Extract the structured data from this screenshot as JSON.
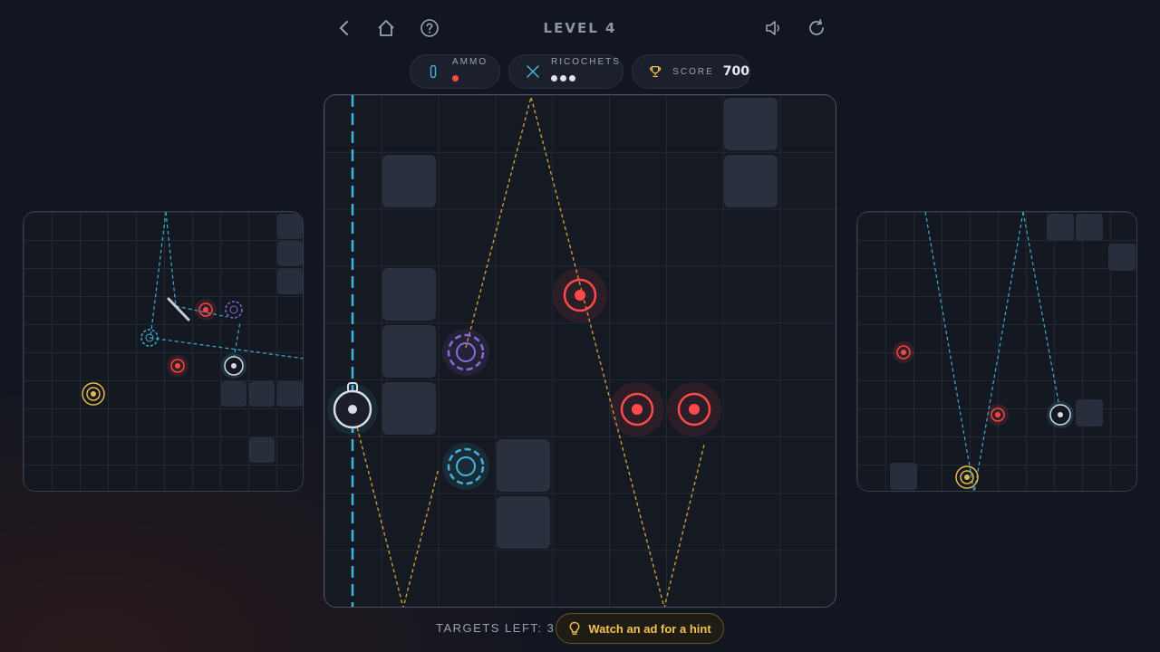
{
  "header": {
    "level_title": "LEVEL 4",
    "icons": [
      "back-icon",
      "home-icon",
      "help-icon",
      "sound-icon",
      "restart-icon"
    ]
  },
  "stats": {
    "ammo_label": "AMMO",
    "ammo_remaining": 1,
    "ricochets_label": "RICOCHETS",
    "ricochets_remaining": 3,
    "score_label": "SCORE",
    "score_value": "700"
  },
  "footer": {
    "targets_left_text": "TARGETS LEFT: 3",
    "hint_button_label": "Watch an ad for a hint"
  },
  "colors": {
    "background": "#121620",
    "target_red": "#ff4a4a",
    "laser_cyan": "#3fb6d8",
    "path_gold": "#c99a3a",
    "portal_purple": "#8a6bd8",
    "accent_gold": "#f2c24d",
    "block": "#2a303d"
  }
}
